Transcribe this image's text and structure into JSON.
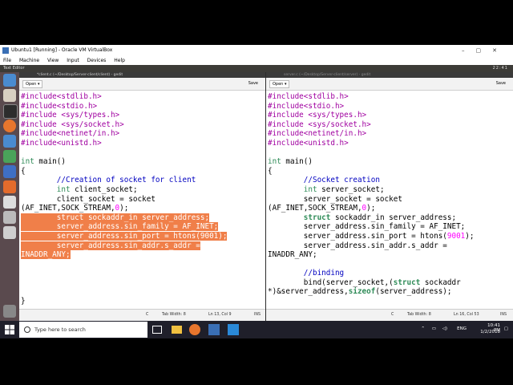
{
  "vbox": {
    "window_title": "Ubuntu1 [Running] - Oracle VM VirtualBox",
    "menu": [
      "File",
      "Machine",
      "View",
      "Input",
      "Devices",
      "Help"
    ]
  },
  "unity": {
    "app_title": "Text Editor",
    "clock": "22:41"
  },
  "left_editor": {
    "title": "*client.c (~/Desktop/Server-client/client) - gedit",
    "open_label": "Open",
    "save_label": "Save",
    "status": {
      "lang": "C",
      "tab": "Tab Width: 8",
      "pos": "Ln 13, Col 9",
      "mode": "INS"
    },
    "lines": [
      "#include<stdlib.h>",
      "#include<stdio.h>",
      "#include <sys/types.h>",
      "#include <sys/socket.h>",
      "#include<netinet/in.h>",
      "#include<unistd.h>",
      "",
      "int main()",
      "{",
      "        //Creation of socket for client",
      "        int client_socket;",
      "        client_socket = socket",
      "(AF_INET,SOCK_STREAM,0);",
      "        struct sockaddr_in server_address;",
      "        server_address.sin_family = AF_INET;",
      "        server_address.sin_port = htons(9001);",
      "        server_address.sin_addr.s_addr =",
      "INADDR_ANY;",
      "",
      "",
      "",
      "",
      "}"
    ]
  },
  "right_editor": {
    "title": "server.c (~/Desktop/Server-client/server) - gedit",
    "open_label": "Open",
    "save_label": "Save",
    "status": {
      "lang": "C",
      "tab": "Tab Width: 8",
      "pos": "Ln 16, Col 53",
      "mode": "INS"
    },
    "lines": [
      "#include<stdlib.h>",
      "#include<stdio.h>",
      "#include <sys/types.h>",
      "#include <sys/socket.h>",
      "#include<netinet/in.h>",
      "#include<unistd.h>",
      "",
      "int main()",
      "{",
      "        //Socket creation",
      "        int server_socket;",
      "        server_socket = socket",
      "(AF_INET,SOCK_STREAM,0);",
      "        struct sockaddr_in server_address;",
      "        server_address.sin_family = AF_INET;",
      "        server_address.sin_port = htons(9001);",
      "        server_address.sin_addr.s_addr =",
      "INADDR_ANY;",
      "",
      "        //binding",
      "        bind(server_socket,(struct sockaddr",
      "*)&server_address,sizeof(server_address);"
    ]
  },
  "taskbar": {
    "search_placeholder": "Type here to search",
    "lang": "ENG",
    "time": "10:41 PM",
    "date": "1/2/2018"
  },
  "colors": {
    "selection": "#f07f49",
    "preprocessor": "#a000a0",
    "keyword": "#2e8b57",
    "comment": "#0000c0",
    "number": "#ff00ff"
  }
}
